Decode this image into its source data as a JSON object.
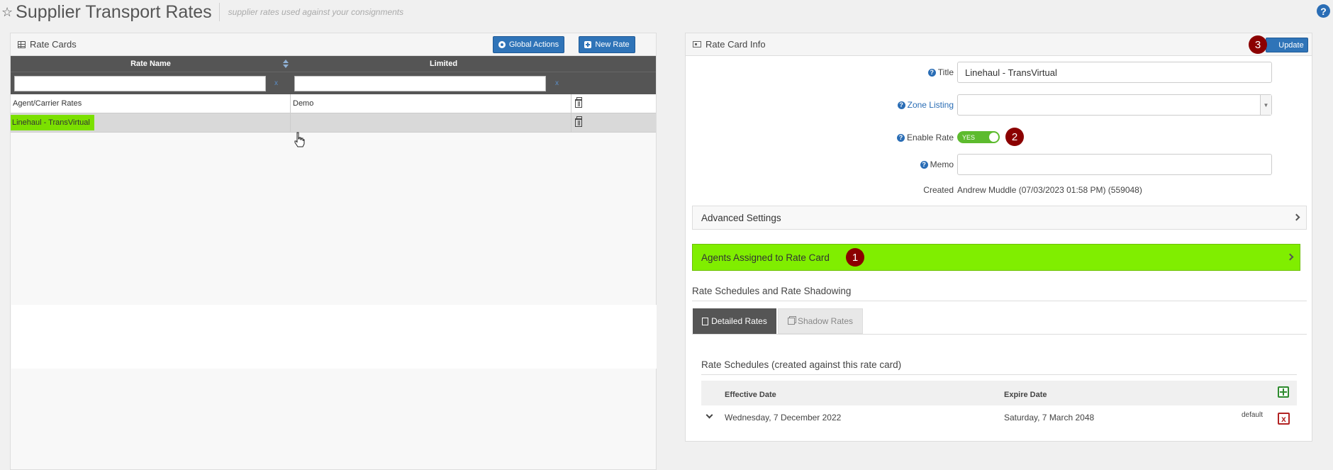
{
  "header": {
    "title": "Supplier Transport Rates",
    "subtitle": "supplier rates used against your consignments",
    "help_glyph": "?"
  },
  "left_panel": {
    "title": "Rate Cards",
    "global_actions_label": "Global Actions",
    "new_rate_label": "New Rate",
    "columns": [
      "Rate Name",
      "Limited"
    ],
    "filter_clear_glyph": "x",
    "filters": {
      "rate_name": "",
      "limited": ""
    },
    "rows": [
      {
        "name": "Agent/Carrier Rates",
        "limited": "Demo"
      },
      {
        "name": "Linehaul - TransVirtual",
        "limited": ""
      }
    ],
    "selected_row": 1
  },
  "right_panel": {
    "title": "Rate Card Info",
    "update_label": "Update",
    "help_glyph": "?",
    "fields": {
      "title_label": "Title",
      "title_value": "Linehaul - TransVirtual",
      "zone_label": "Zone Listing",
      "zone_value": "",
      "enable_label": "Enable Rate",
      "enable_value": "YES",
      "memo_label": "Memo",
      "memo_value": "",
      "created_label": "Created",
      "created_value": "Andrew Muddle (07/03/2023 01:58 PM) (559048)"
    },
    "advanced_settings": "Advanced Settings",
    "agents_assigned": "Agents Assigned to Rate Card",
    "schedules_section": "Rate Schedules and Rate Shadowing",
    "tabs": [
      {
        "label": "Detailed Rates",
        "active": true
      },
      {
        "label": "Shadow Rates",
        "active": false
      }
    ],
    "schedules": {
      "title": "Rate Schedules (created against this rate card)",
      "columns": [
        "Effective Date",
        "Expire Date"
      ],
      "rows": [
        {
          "effective": "Wednesday, 7 December 2022",
          "expire": "Saturday, 7 March 2048",
          "tag": "default"
        }
      ],
      "delete_glyph": "x"
    }
  },
  "badges": [
    "1",
    "2",
    "3"
  ],
  "colors": {
    "accent_blue": "#2f74b8",
    "highlight_green": "#80ee00",
    "badge_red": "#8b0000",
    "toggle_green": "#5dbb2e"
  }
}
